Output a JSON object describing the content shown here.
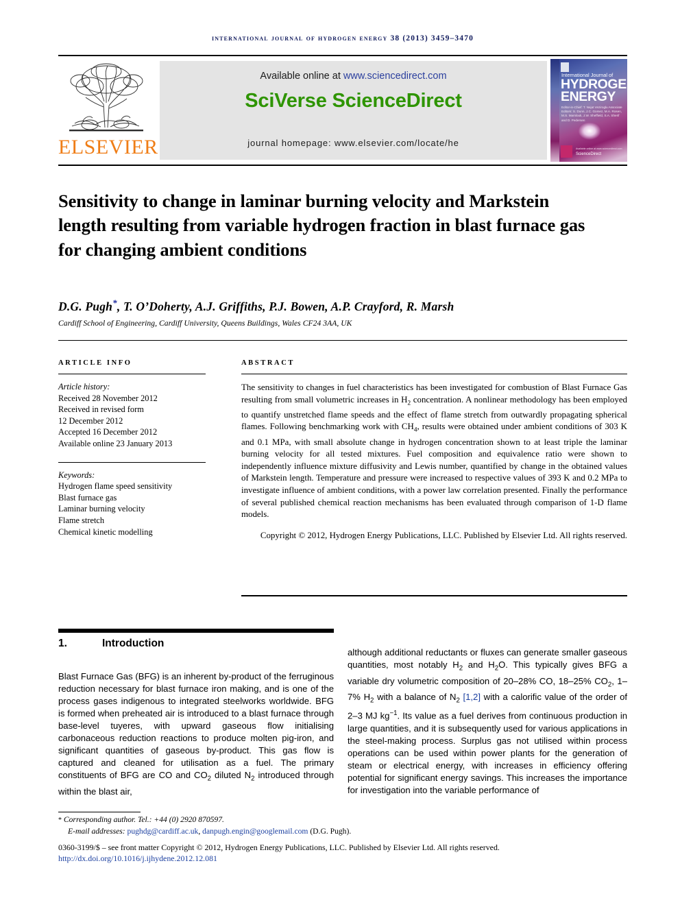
{
  "running_head": "international journal of hydrogen energy 38 (2013) 3459–3470",
  "masthead": {
    "publisher_name": "ELSEVIER",
    "available_prefix": "Available online at ",
    "available_url": "www.sciencedirect.com",
    "platform": "SciVerse ScienceDirect",
    "homepage": "journal homepage: www.elsevier.com/locate/he",
    "cover": {
      "line_small": "International Journal of",
      "line_big_1": "HYDROGEN",
      "line_big_2": "ENERGY",
      "editors": "Editor-in-Chief: T. Nejat Veziroglu   Associate Editors: S. Dunn, J.C. Gomez, M.A. Rosen, M.S. Mamlouk, J.W. Sheffield, S.A. Sherif and D. Pedersen",
      "sciencedirect_label": "ScienceDirect",
      "sciencedirect_tiny": "Available online at www.sciencedirect.com"
    }
  },
  "article": {
    "title": "Sensitivity to change in laminar burning velocity and Markstein length resulting from variable hydrogen fraction in blast furnace gas for changing ambient conditions",
    "authors": "D.G. Pugh*, T. O’Doherty, A.J. Griffiths, P.J. Bowen, A.P. Crayford, R. Marsh",
    "affiliation": "Cardiff School of Engineering, Cardiff University, Queens Buildings, Wales CF24 3AA, UK"
  },
  "article_info": {
    "heading": "ARTICLE INFO",
    "history_label": "Article history:",
    "history": [
      "Received 28 November 2012",
      "Received in revised form",
      "12 December 2012",
      "Accepted 16 December 2012",
      "Available online 23 January 2013"
    ],
    "keywords_label": "Keywords:",
    "keywords": [
      "Hydrogen flame speed sensitivity",
      "Blast furnace gas",
      "Laminar burning velocity",
      "Flame stretch",
      "Chemical kinetic modelling"
    ]
  },
  "abstract": {
    "heading": "ABSTRACT",
    "part1": "The sensitivity to changes in fuel characteristics has been investigated for combustion of Blast Furnace Gas resulting from small volumetric increases in H",
    "sub1": "2",
    "part2": " concentration. A nonlinear methodology has been employed to quantify unstretched flame speeds and the effect of flame stretch from outwardly propagating spherical flames. Following benchmarking work with CH",
    "sub2": "4",
    "part3": ", results were obtained under ambient conditions of 303 K and 0.1 MPa, with small absolute change in hydrogen concentration shown to at least triple the laminar burning velocity for all tested mixtures. Fuel composition and equivalence ratio were shown to independently influence mixture diffusivity and Lewis number, quantified by change in the obtained values of Markstein length. Temperature and pressure were increased to respective values of 393 K and 0.2 MPa to investigate influence of ambient conditions, with a power law correlation presented. Finally the performance of several published chemical reaction mechanisms has been evaluated through comparison of 1-D flame models.",
    "copyright": "Copyright © 2012, Hydrogen Energy Publications, LLC. Published by Elsevier Ltd. All rights reserved."
  },
  "body": {
    "section_number": "1.",
    "section_title": "Introduction",
    "left_column": "Blast Furnace Gas (BFG) is an inherent by-product of the ferruginous reduction necessary for blast furnace iron making, and is one of the process gases indigenous to integrated steelworks worldwide. BFG is formed when preheated air is introduced to a blast furnace through base-level tuyeres, with upward gaseous flow initialising carbonaceous reduction reactions to produce molten pig-iron, and significant quantities of gaseous by-product. This gas flow is captured and cleaned for utilisation as a fuel. The primary constituents of BFG are CO and CO",
    "left_column_sub1": "2",
    "left_column_b": " diluted N",
    "left_column_sub2": "2",
    "left_column_c": " introduced through within the blast air,",
    "right_a": "although additional reductants or fluxes can generate smaller gaseous quantities, most notably H",
    "right_sub1": "2",
    "right_b": " and H",
    "right_sub2": "2",
    "right_c": "O. This typically gives BFG a variable dry volumetric composition of 20–28% CO, 18–25% CO",
    "right_sub3": "2",
    "right_d": ", 1–7% H",
    "right_sub4": "2",
    "right_e": " with a balance of N",
    "right_sub5": "2",
    "right_citation": "[1,2]",
    "right_f": " with a calorific value of the order of 2–3 MJ kg",
    "right_sup1": "−1",
    "right_g": ". Its value as a fuel derives from continuous production in large quantities, and it is subsequently used for various applications in the steel-making process. Surplus gas not utilised within process operations can be used within power plants for the generation of steam or electrical energy, with increases in efficiency offering potential for significant energy savings. This increases the importance for investigation into the variable performance of"
  },
  "footer": {
    "corresponding_star": "*",
    "corresponding": " Corresponding author. Tel.: +44 (0) 2920 870597.",
    "email_label": "E-mail addresses: ",
    "email1": "pughdg@cardiff.ac.uk",
    "email_sep": ", ",
    "email2": "danpugh.engin@googlemail.com",
    "email_suffix": " (D.G. Pugh).",
    "issn_line": "0360-3199/$ – see front matter Copyright © 2012, Hydrogen Energy Publications, LLC. Published by Elsevier Ltd. All rights reserved.",
    "doi": "http://dx.doi.org/10.1016/j.ijhydene.2012.12.081"
  },
  "colors": {
    "running_head": "#101a5c",
    "elsevier_orange": "#ef7d16",
    "sciverse_green": "#2e9400",
    "link_blue": "#1b3fa0"
  }
}
